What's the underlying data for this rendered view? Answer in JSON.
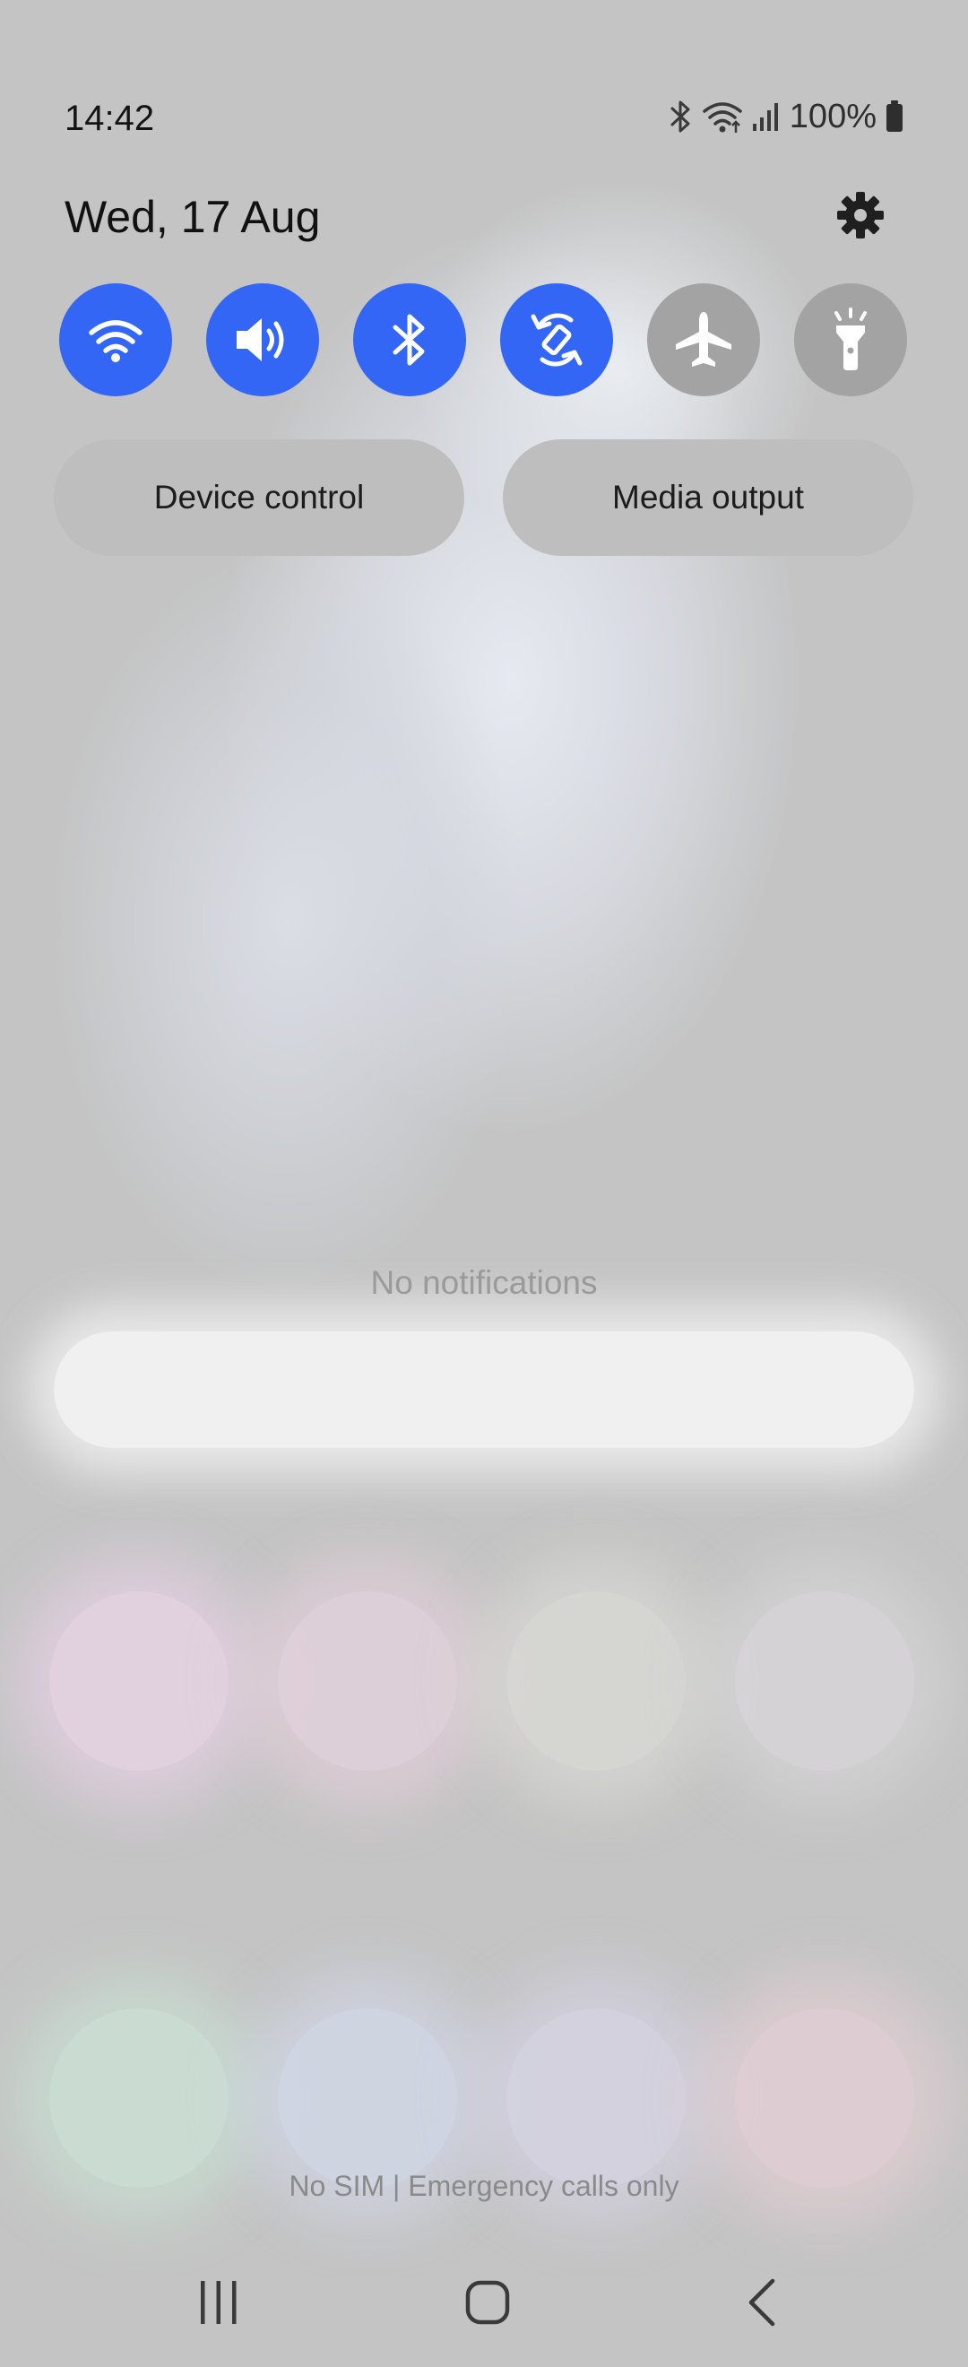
{
  "status_bar": {
    "time": "14:42",
    "battery": "100%",
    "icons": [
      "bluetooth-icon",
      "wifi-icon",
      "signal-icon",
      "battery-icon"
    ]
  },
  "header": {
    "date": "Wed, 17 Aug",
    "settings_icon": "gear-icon"
  },
  "quick_toggles": [
    {
      "icon": "wifi-icon",
      "state": "on"
    },
    {
      "icon": "sound-icon",
      "state": "on"
    },
    {
      "icon": "bluetooth-icon",
      "state": "on"
    },
    {
      "icon": "auto-rotate-icon",
      "state": "on"
    },
    {
      "icon": "airplane-icon",
      "state": "off"
    },
    {
      "icon": "flashlight-icon",
      "state": "off"
    }
  ],
  "buttons": {
    "device_control": "Device control",
    "media_output": "Media output"
  },
  "notifications": {
    "empty_text": "No notifications"
  },
  "footer": {
    "carrier_text": "No SIM | Emergency calls only"
  },
  "nav_bar": {
    "icons": [
      "recents-icon",
      "home-icon",
      "back-icon"
    ]
  },
  "colors": {
    "toggle_on": "#3366f4",
    "toggle_off": "#a3a3a3",
    "panel_background": "#c4c4c4"
  }
}
